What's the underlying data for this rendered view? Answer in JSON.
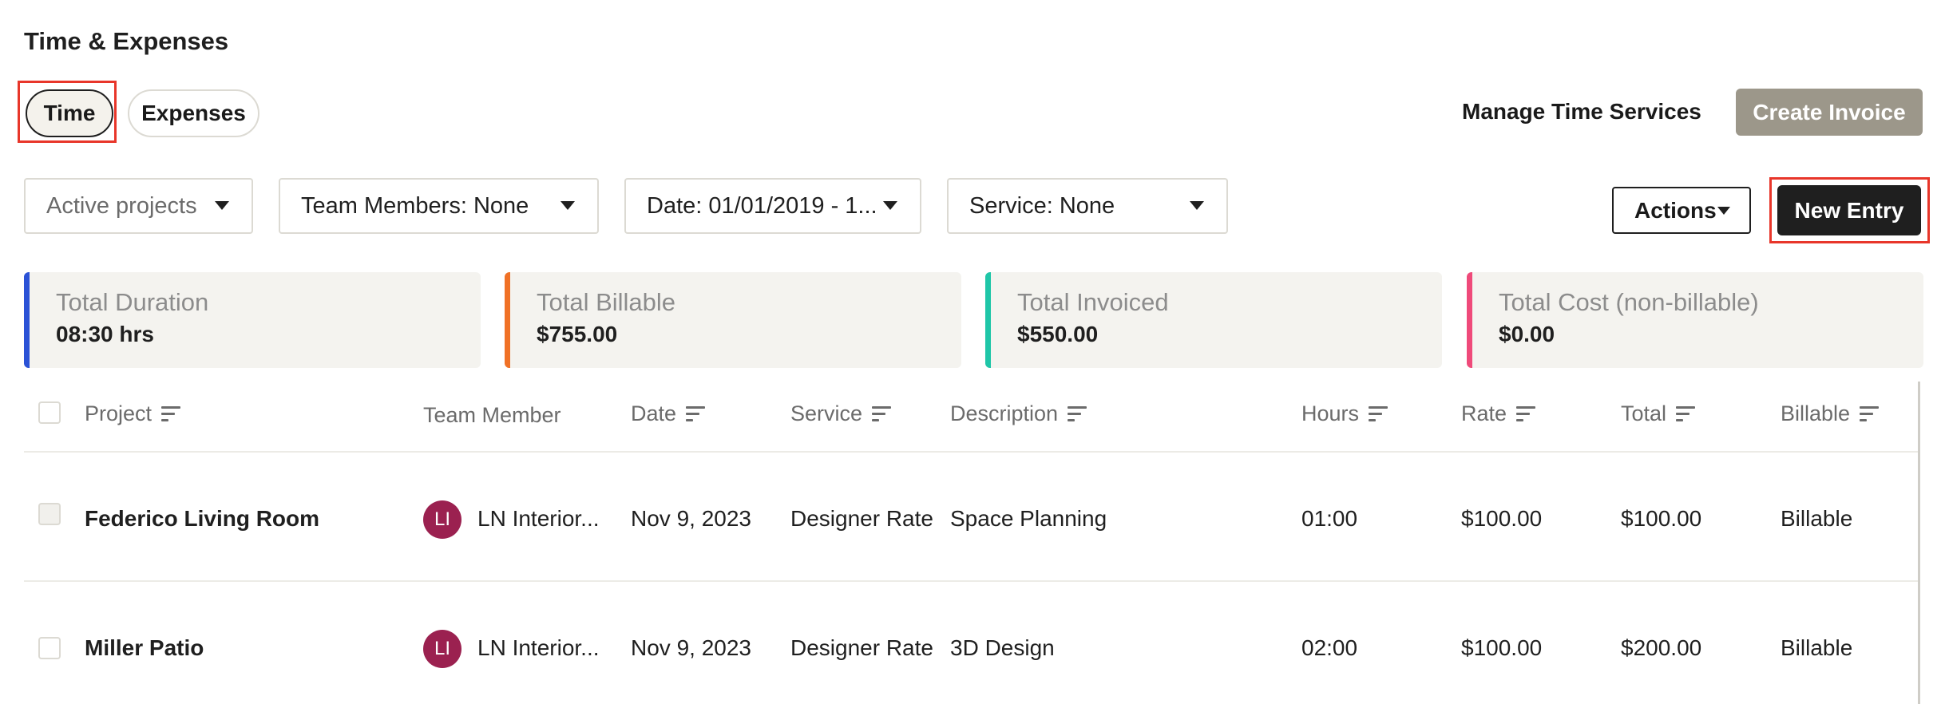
{
  "page": {
    "title": "Time & Expenses"
  },
  "tabs": [
    {
      "label": "Time",
      "active": true
    },
    {
      "label": "Expenses",
      "active": false
    }
  ],
  "header_actions": {
    "manage_link": "Manage Time Services",
    "create_invoice": "Create Invoice"
  },
  "filters": {
    "projects": "Active projects",
    "team_members": "Team Members: None",
    "date": "Date: 01/01/2019 - 1...",
    "service": "Service: None"
  },
  "toolbar": {
    "actions": "Actions",
    "new_entry": "New Entry"
  },
  "summary": [
    {
      "label": "Total Duration",
      "value": "08:30 hrs",
      "color": "#2b52d6"
    },
    {
      "label": "Total Billable",
      "value": "$755.00",
      "color": "#f07126"
    },
    {
      "label": "Total Invoiced",
      "value": "$550.00",
      "color": "#1fc6a8"
    },
    {
      "label": "Total Cost (non-billable)",
      "value": "$0.00",
      "color": "#ef4a7a"
    }
  ],
  "table": {
    "columns": [
      "Project",
      "Team Member",
      "Date",
      "Service",
      "Description",
      "Hours",
      "Rate",
      "Total",
      "Billable"
    ],
    "rows": [
      {
        "project": "Federico Living Room",
        "avatar": "LI",
        "team_member": "LN Interior...",
        "date": "Nov 9, 2023",
        "service": "Designer Rate",
        "description": "Space Planning",
        "hours": "01:00",
        "rate": "$100.00",
        "total": "$100.00",
        "billable": "Billable"
      },
      {
        "project": "Miller Patio",
        "avatar": "LI",
        "team_member": "LN Interior...",
        "date": "Nov 9, 2023",
        "service": "Designer Rate",
        "description": "3D Design",
        "hours": "02:00",
        "rate": "$100.00",
        "total": "$200.00",
        "billable": "Billable"
      }
    ]
  }
}
